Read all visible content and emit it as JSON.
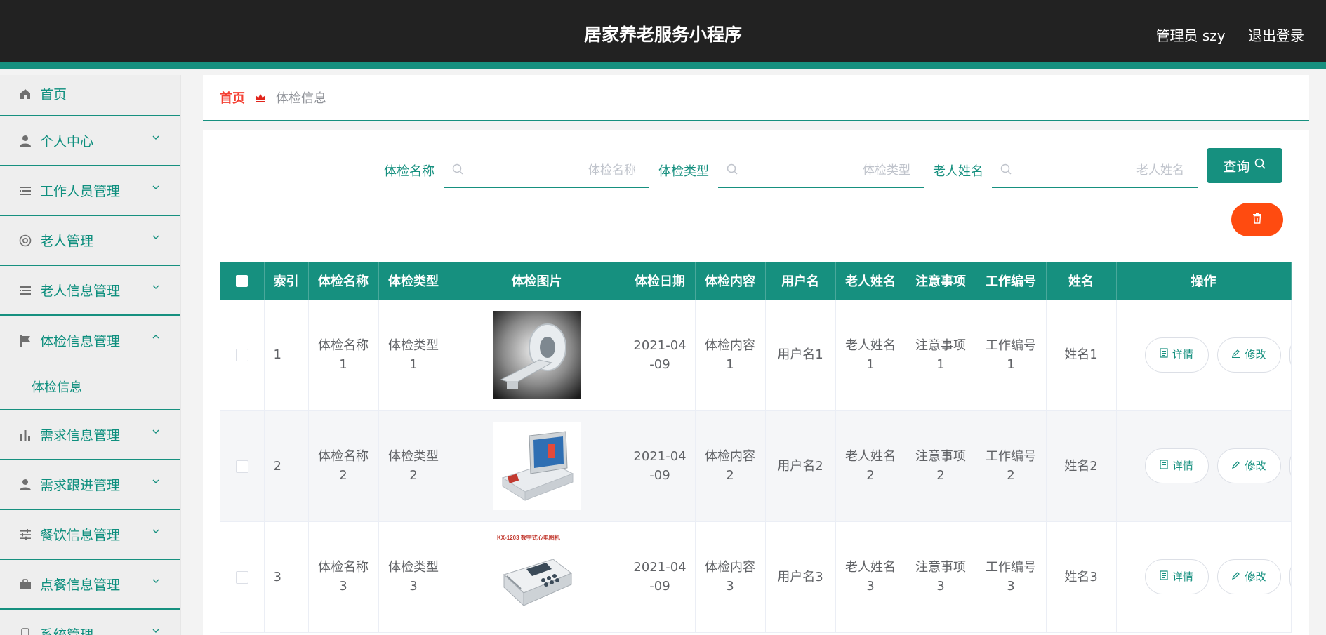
{
  "header": {
    "title": "居家养老服务小程序",
    "admin_label": "管理员 szy",
    "logout_label": "退出登录"
  },
  "sidebar": {
    "home": "首页",
    "items": [
      {
        "label": "个人中心",
        "icon": "user-icon"
      },
      {
        "label": "工作人员管理",
        "icon": "list-icon"
      },
      {
        "label": "老人管理",
        "icon": "lifebuoy-icon"
      },
      {
        "label": "老人信息管理",
        "icon": "list-icon"
      },
      {
        "label": "体检信息管理",
        "icon": "flag-icon",
        "expanded": true,
        "sub": "体检信息"
      },
      {
        "label": "需求信息管理",
        "icon": "bar-chart-icon"
      },
      {
        "label": "需求跟进管理",
        "icon": "user-icon"
      },
      {
        "label": "餐饮信息管理",
        "icon": "sliders-icon"
      },
      {
        "label": "点餐信息管理",
        "icon": "briefcase-icon"
      },
      {
        "label": "系统管理",
        "icon": "phone-icon"
      }
    ]
  },
  "breadcrumb": {
    "home": "首页",
    "current": "体检信息"
  },
  "search": {
    "fields": [
      {
        "label": "体检名称",
        "placeholder": "体检名称"
      },
      {
        "label": "体检类型",
        "placeholder": "体检类型"
      },
      {
        "label": "老人姓名",
        "placeholder": "老人姓名"
      }
    ],
    "query_label": "查询"
  },
  "table": {
    "columns": [
      "索引",
      "体检名称",
      "体检类型",
      "体检图片",
      "体检日期",
      "体检内容",
      "用户名",
      "老人姓名",
      "注意事项",
      "工作编号",
      "姓名",
      "操作"
    ],
    "rows": [
      {
        "index": "1",
        "name": "体检名称1",
        "type": "体检类型1",
        "image": "ct-scanner-photo",
        "date": "2021-04-09",
        "content": "体检内容1",
        "username": "用户名1",
        "elder": "老人姓名1",
        "notes": "注意事项1",
        "workno": "工作编号1",
        "person": "姓名1"
      },
      {
        "index": "2",
        "name": "体检名称2",
        "type": "体检类型2",
        "image": "analyzer-device-photo",
        "date": "2021-04-09",
        "content": "体检内容2",
        "username": "用户名2",
        "elder": "老人姓名2",
        "notes": "注意事项2",
        "workno": "工作编号2",
        "person": "姓名2"
      },
      {
        "index": "3",
        "name": "体检名称3",
        "type": "体检类型3",
        "image": "ecg-machine-photo",
        "image_caption": "KX-1203 数字式心电图机",
        "date": "2021-04-09",
        "content": "体检内容3",
        "username": "用户名3",
        "elder": "老人姓名3",
        "notes": "注意事项3",
        "workno": "工作编号3",
        "person": "姓名3"
      }
    ],
    "actions": {
      "detail": "详情",
      "edit": "修改"
    }
  },
  "colors": {
    "accent": "#16907f",
    "topbar": "#222222",
    "danger": "#ff4b10",
    "breadcrumb_home": "#f43f32"
  }
}
